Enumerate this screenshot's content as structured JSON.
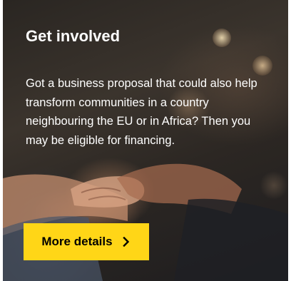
{
  "card": {
    "title": "Get involved",
    "description": "Got a business proposal that could also help transform communities in a country neighbouring the EU or in Africa? Then you may be eligible for financing.",
    "cta": {
      "label": "More details",
      "icon": "chevron-right-icon"
    },
    "background_image": "handshake-photo",
    "colors": {
      "button": "#ffd617",
      "text": "#ffffff",
      "button_text": "#000000"
    }
  }
}
